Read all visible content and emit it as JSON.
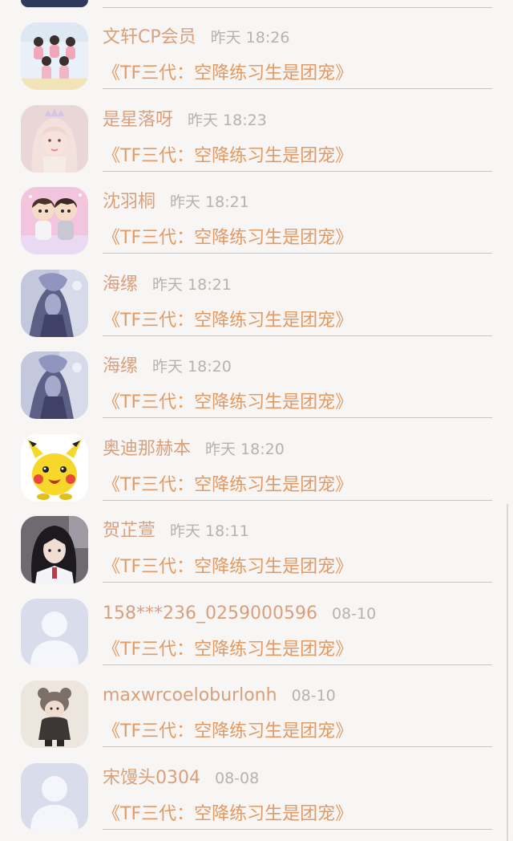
{
  "list": {
    "items": [
      {
        "name": "文轩CP会员",
        "time": "昨天 18:26",
        "title": "《TF三代：空降练习生是团宠》",
        "avatar": "group-photo"
      },
      {
        "name": "是星落呀",
        "time": "昨天 18:23",
        "title": "《TF三代：空降练习生是团宠》",
        "avatar": "blonde-girl-crown"
      },
      {
        "name": "沈羽桐",
        "time": "昨天 18:21",
        "title": "《TF三代：空降练习生是团宠》",
        "avatar": "cartoon-boys"
      },
      {
        "name": "海缧",
        "time": "昨天 18:21",
        "title": "《TF三代：空降练习生是团宠》",
        "avatar": "anime-character"
      },
      {
        "name": "海缧",
        "time": "昨天 18:20",
        "title": "《TF三代：空降练习生是团宠》",
        "avatar": "anime-character"
      },
      {
        "name": "奥迪那赫本",
        "time": "昨天 18:20",
        "title": "《TF三代：空降练习生是团宠》",
        "avatar": "pikachu"
      },
      {
        "name": "贺芷萱",
        "time": "昨天 18:11",
        "title": "《TF三代：空降练习生是团宠》",
        "avatar": "dark-hair-girl"
      },
      {
        "name": "158***236_0259000596",
        "time": "08-10",
        "title": "《TF三代：空降练习生是团宠》",
        "avatar": "default-user"
      },
      {
        "name": "maxwrcoeloburlonh",
        "time": "08-10",
        "title": "《TF三代：空降练习生是团宠》",
        "avatar": "bear-hat-child"
      },
      {
        "name": "宋馒头0304",
        "time": "08-08",
        "title": "《TF三代：空降练习生是团宠》",
        "avatar": "default-user"
      }
    ]
  },
  "colors": {
    "background": "#f8f5f5",
    "name": "#d9a07c",
    "time": "#b6b2b2",
    "title": "#e39a62",
    "divider": "#c8c4c4"
  }
}
